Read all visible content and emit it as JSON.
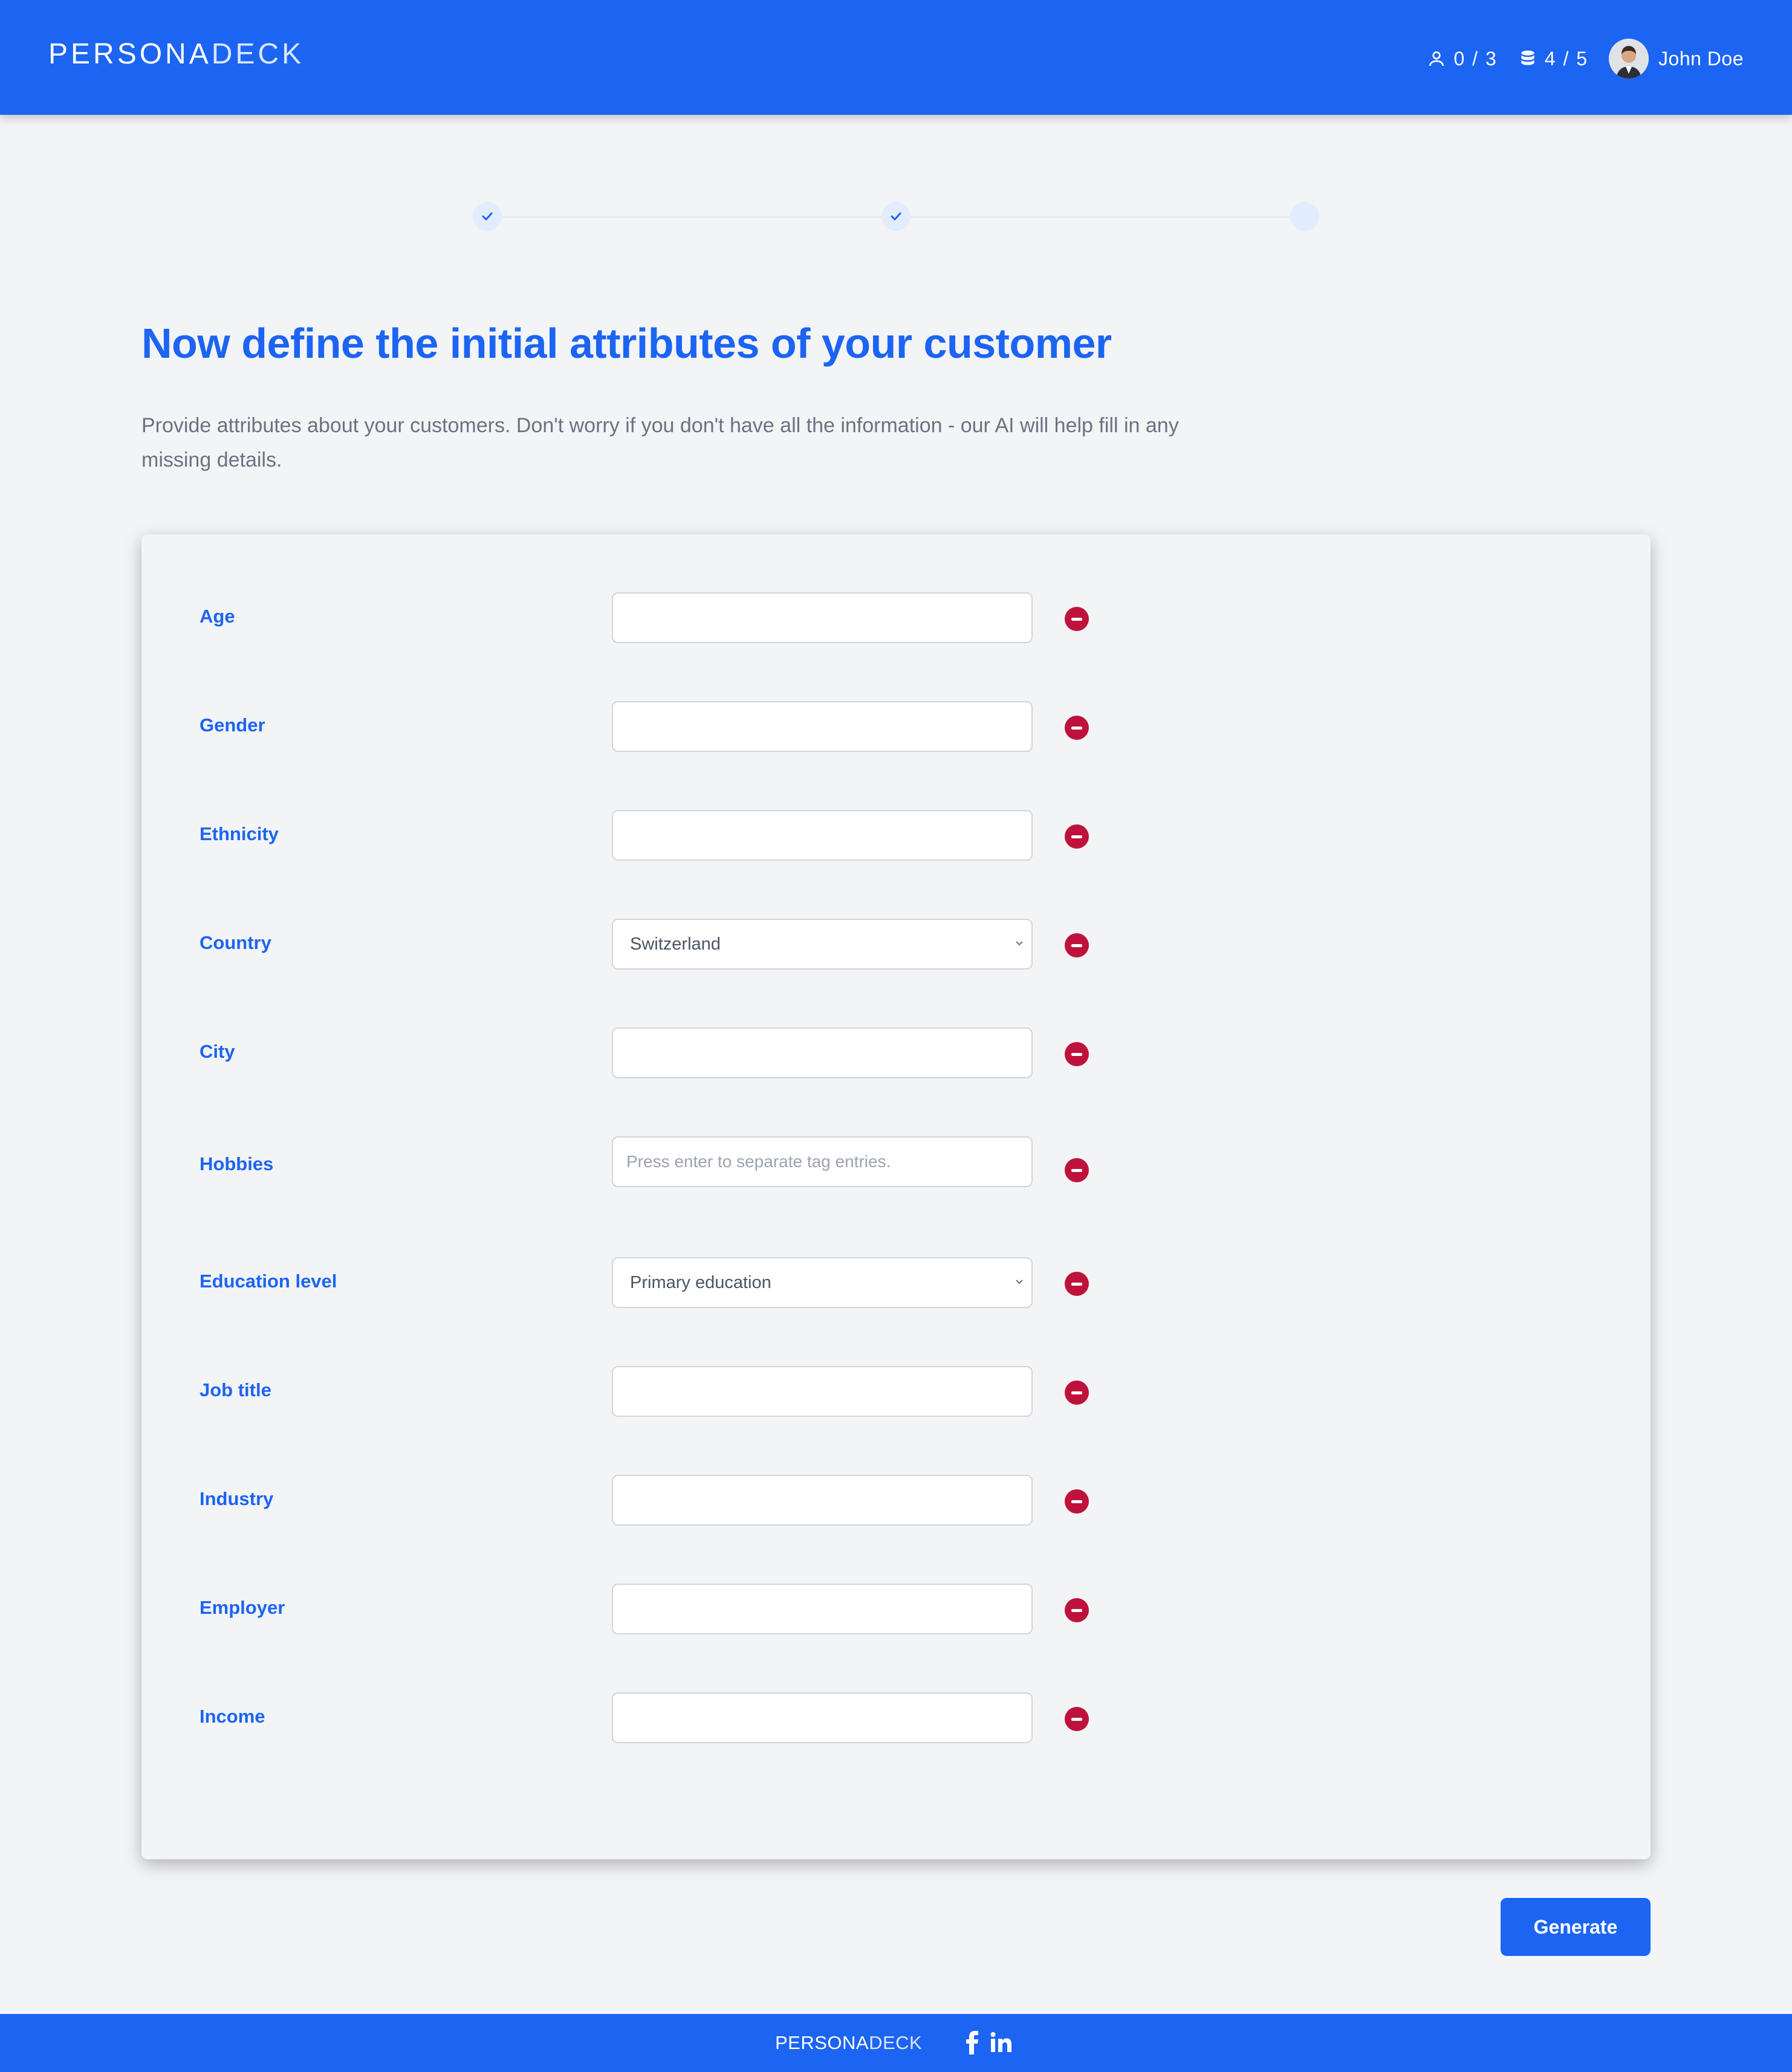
{
  "header": {
    "logo_strong": "PERSONA",
    "logo_light": "DECK",
    "personas_count": "0 / 3",
    "credits_count": "4 / 5",
    "user_name": "John Doe"
  },
  "stepper": {
    "steps": [
      "done",
      "done",
      "current"
    ]
  },
  "page": {
    "title": "Now define the initial attributes of your customer",
    "description": "Provide attributes about your customers. Don't worry if you don't have all the information - our AI will help fill in any missing details."
  },
  "form": {
    "age": {
      "label": "Age",
      "value": ""
    },
    "gender": {
      "label": "Gender",
      "value": ""
    },
    "ethnicity": {
      "label": "Ethnicity",
      "value": ""
    },
    "country": {
      "label": "Country",
      "value": "Switzerland"
    },
    "city": {
      "label": "City",
      "value": ""
    },
    "hobbies": {
      "label": "Hobbies",
      "placeholder": "Press enter to separate tag entries."
    },
    "education": {
      "label": "Education level",
      "value": "Primary education"
    },
    "job_title": {
      "label": "Job title",
      "value": ""
    },
    "industry": {
      "label": "Industry",
      "value": ""
    },
    "employer": {
      "label": "Employer",
      "value": ""
    },
    "income": {
      "label": "Income",
      "value": ""
    }
  },
  "actions": {
    "generate_label": "Generate"
  },
  "footer": {
    "logo_strong": "PERSONA",
    "logo_light": "DECK",
    "facebook_icon": "f",
    "linkedin_icon": "in"
  },
  "colors": {
    "brand": "#1c64f2",
    "danger": "#be123c",
    "background": "#f3f4f6"
  }
}
